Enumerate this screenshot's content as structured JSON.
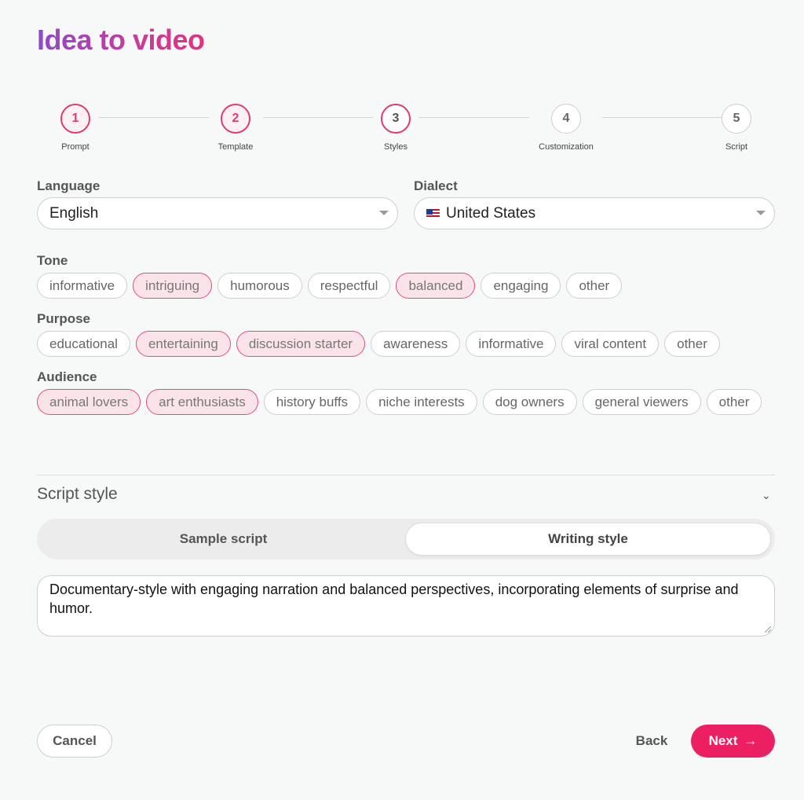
{
  "title": "Idea to video",
  "stepper": {
    "steps": [
      {
        "number": "1",
        "label": "Prompt"
      },
      {
        "number": "2",
        "label": "Template"
      },
      {
        "number": "3",
        "label": "Styles"
      },
      {
        "number": "4",
        "label": "Customization"
      },
      {
        "number": "5",
        "label": "Script"
      }
    ]
  },
  "language": {
    "label": "Language",
    "value": "English"
  },
  "dialect": {
    "label": "Dialect",
    "value": "United States"
  },
  "tone": {
    "label": "Tone",
    "chips": [
      "informative",
      "intriguing",
      "humorous",
      "respectful",
      "balanced",
      "engaging",
      "other"
    ],
    "selected": [
      "intriguing",
      "balanced"
    ]
  },
  "purpose": {
    "label": "Purpose",
    "chips": [
      "educational",
      "entertaining",
      "discussion starter",
      "awareness",
      "informative",
      "viral content",
      "other"
    ],
    "selected": [
      "entertaining",
      "discussion starter"
    ]
  },
  "audience": {
    "label": "Audience",
    "chips": [
      "animal lovers",
      "art enthusiasts",
      "history buffs",
      "niche interests",
      "dog owners",
      "general viewers",
      "other"
    ],
    "selected": [
      "animal lovers",
      "art enthusiasts"
    ]
  },
  "script_style": {
    "title": "Script style",
    "chevron": "⌄",
    "tabs": [
      "Sample script",
      "Writing style"
    ],
    "active_tab": "Writing style",
    "text": "Documentary-style with engaging narration and balanced perspectives, incorporating elements of surprise and humor."
  },
  "footer": {
    "cancel": "Cancel",
    "back": "Back",
    "next": "Next",
    "next_arrow": "→"
  },
  "colors": {
    "accent": "#ec1f63",
    "chip_selected_bg": "#fbe3ea",
    "chip_selected_border": "#e34c7a"
  },
  "icons": {
    "dropdown": "caret-down-icon",
    "flag": "us-flag-icon",
    "collapse": "chevron-down-icon",
    "next": "arrow-right-icon"
  }
}
